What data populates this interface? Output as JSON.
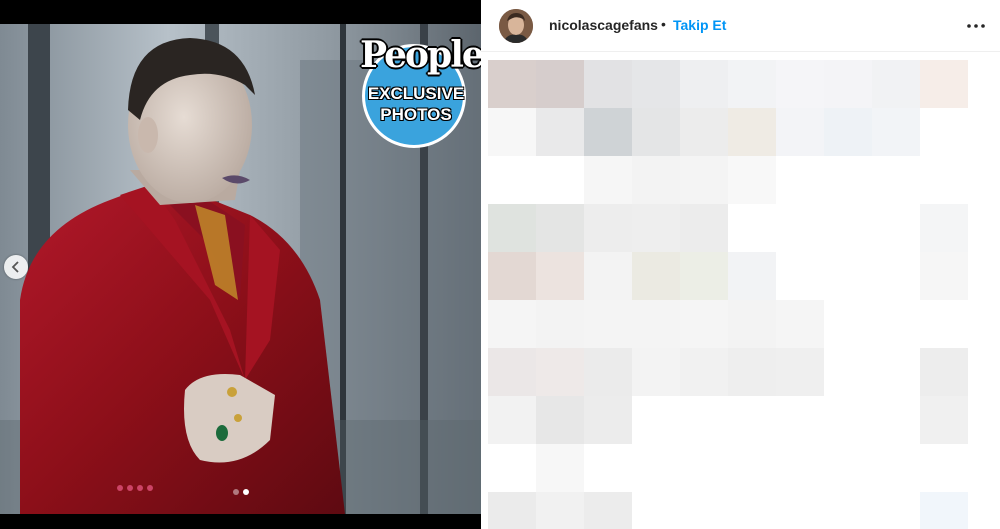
{
  "post": {
    "username": "nicolascagefans",
    "separator": "•",
    "follow_label": "Takip Et",
    "more_icon": "more-horizontal-icon"
  },
  "media": {
    "badge": {
      "logo": "People",
      "line1": "EXCLUSIVE",
      "line2": "PHOTOS"
    },
    "carousel": {
      "count": 2,
      "active_index": 1,
      "prev_icon": "chevron-left-icon"
    }
  },
  "colors": {
    "link": "#0095f6",
    "text": "#262626",
    "badge_blue": "#3aa3dd",
    "jacket_red": "#8c0f19"
  }
}
